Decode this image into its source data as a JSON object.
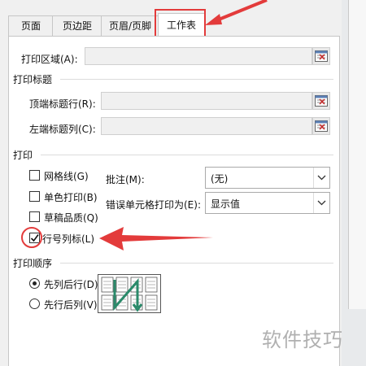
{
  "tabs": [
    {
      "label": "页面"
    },
    {
      "label": "页边距"
    },
    {
      "label": "页眉/页脚"
    },
    {
      "label": "工作表"
    }
  ],
  "print_area": {
    "label": "打印区域(A):",
    "value": ""
  },
  "print_titles": {
    "heading": "打印标题",
    "top_rows": {
      "label": "顶端标题行(R):",
      "value": ""
    },
    "left_columns": {
      "label": "左端标题列(C):",
      "value": ""
    }
  },
  "print": {
    "heading": "打印",
    "gridlines": {
      "label": "网格线(G)",
      "checked": false
    },
    "black_white": {
      "label": "单色打印(B)",
      "checked": false
    },
    "draft_quality": {
      "label": "草稿品质(Q)",
      "checked": false
    },
    "row_col_headings": {
      "label": "行号列标(L)",
      "checked": true
    },
    "comments": {
      "label": "批注(M):",
      "value": "(无)"
    },
    "cell_errors": {
      "label": "错误单元格打印为(E):",
      "value": "显示值"
    }
  },
  "page_order": {
    "heading": "打印顺序",
    "down_then_over": {
      "label": "先列后行(D)",
      "selected": true
    },
    "over_then_down": {
      "label": "先行后列(V)",
      "selected": false
    }
  },
  "watermark": "软件技巧",
  "colors": {
    "annotation_red": "#e33b3b",
    "preview_arrow": "#2a8a6a"
  }
}
